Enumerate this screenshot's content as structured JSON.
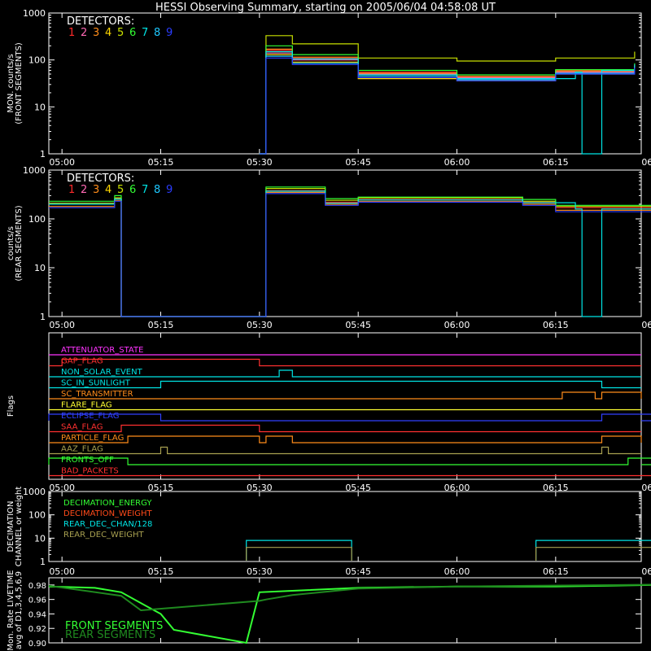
{
  "title": "HESSI Observing Summary, starting on 2005/06/04 04:58:08 UT",
  "x_tick_labels": [
    "05:00",
    "05:15",
    "05:30",
    "05:45",
    "06:00",
    "06:15",
    "06:30"
  ],
  "detector_colors": [
    "#ff2a2a",
    "#ff69b4",
    "#ff8c1a",
    "#ffd700",
    "#c8e000",
    "#33ff33",
    "#00e5e5",
    "#1ec8ff",
    "#2b3dff"
  ],
  "chart_data": [
    {
      "type": "line",
      "title": "HESSI Observing Summary, starting on 2005/06/04 04:58:08 UT",
      "ylabel": "MON. counts/s (FRONT SEGMENTS)",
      "yscale": "log",
      "ylim": [
        1,
        1000
      ],
      "y_tick_labels": [
        "1",
        "10",
        "100",
        "1000"
      ],
      "x_tick_labels": [
        "05:00",
        "05:15",
        "05:30",
        "05:45",
        "06:00",
        "06:15",
        "06:30"
      ],
      "xlim_minutes": [
        298,
        388
      ],
      "legend_title": "DETECTORS:",
      "legend_entries": [
        "1",
        "2",
        "3",
        "4",
        "5",
        "6",
        "7",
        "8",
        "9"
      ],
      "series": [
        {
          "detector": "1",
          "x": [
            "05:30",
            "05:31",
            "05:35",
            "05:45",
            "06:00",
            "06:15",
            "06:27"
          ],
          "y": [
            1,
            160,
            110,
            55,
            45,
            60,
            80
          ]
        },
        {
          "detector": "2",
          "x": [
            "05:30",
            "05:31",
            "05:35",
            "05:45",
            "06:00",
            "06:15",
            "06:27"
          ],
          "y": [
            1,
            140,
            100,
            50,
            42,
            55,
            75
          ]
        },
        {
          "detector": "3",
          "x": [
            "05:30",
            "05:31",
            "05:35",
            "05:45",
            "06:00",
            "06:15",
            "06:27"
          ],
          "y": [
            1,
            170,
            115,
            52,
            44,
            58,
            78
          ]
        },
        {
          "detector": "4",
          "x": [
            "05:30",
            "05:31",
            "05:35",
            "05:45",
            "06:00",
            "06:15",
            "06:27"
          ],
          "y": [
            1,
            130,
            90,
            40,
            36,
            50,
            70
          ]
        },
        {
          "detector": "5",
          "x": [
            "05:30",
            "05:31",
            "05:35",
            "05:45",
            "06:00",
            "06:15",
            "06:27"
          ],
          "y": [
            1,
            330,
            220,
            110,
            95,
            110,
            150
          ]
        },
        {
          "detector": "6",
          "x": [
            "05:30",
            "05:31",
            "05:35",
            "05:45",
            "06:00",
            "06:15",
            "06:27"
          ],
          "y": [
            1,
            200,
            130,
            60,
            48,
            62,
            85
          ]
        },
        {
          "detector": "7",
          "x": [
            "05:30",
            "05:31",
            "05:35",
            "05:45",
            "06:00",
            "06:18",
            "06:19",
            "06:22",
            "06:27"
          ],
          "y": [
            1,
            150,
            105,
            48,
            40,
            55,
            1,
            60,
            80
          ]
        },
        {
          "detector": "8",
          "x": [
            "05:30",
            "05:31",
            "05:35",
            "05:45",
            "06:00",
            "06:15",
            "06:27"
          ],
          "y": [
            1,
            120,
            85,
            45,
            38,
            52,
            72
          ]
        },
        {
          "detector": "9",
          "x": [
            "05:30",
            "05:31",
            "05:35",
            "05:45",
            "06:00",
            "06:15",
            "06:27"
          ],
          "y": [
            1,
            110,
            80,
            42,
            36,
            50,
            68
          ]
        }
      ]
    },
    {
      "type": "line",
      "ylabel": "counts/s (REAR SEGMENTS)",
      "yscale": "log",
      "ylim": [
        1,
        1000
      ],
      "y_tick_labels": [
        "1",
        "10",
        "100",
        "1000"
      ],
      "x_tick_labels": [
        "05:00",
        "05:15",
        "05:30",
        "05:45",
        "06:00",
        "06:15",
        "06:30"
      ],
      "xlim_minutes": [
        298,
        388
      ],
      "legend_title": "DETECTORS:",
      "legend_entries": [
        "1",
        "2",
        "3",
        "4",
        "5",
        "6",
        "7",
        "8",
        "9"
      ],
      "series": [
        {
          "detector": "1",
          "x": [
            "04:58",
            "05:08",
            "05:09",
            "05:30",
            "05:31",
            "05:40",
            "05:45",
            "06:10",
            "06:15",
            "06:30",
            "06:37"
          ],
          "y": [
            200,
            260,
            1,
            1,
            380,
            220,
            250,
            220,
            170,
            160,
            250
          ]
        },
        {
          "detector": "3",
          "x": [
            "04:58",
            "05:08",
            "05:09",
            "05:30",
            "05:31",
            "05:40",
            "05:45",
            "06:10",
            "06:15",
            "06:30",
            "06:37"
          ],
          "y": [
            180,
            240,
            1,
            1,
            350,
            200,
            230,
            200,
            150,
            145,
            230
          ]
        },
        {
          "detector": "5",
          "x": [
            "04:58",
            "05:08",
            "05:09",
            "05:30",
            "05:31",
            "05:40",
            "05:45",
            "06:10",
            "06:15",
            "06:30",
            "06:37"
          ],
          "y": [
            210,
            270,
            1,
            1,
            420,
            240,
            270,
            230,
            180,
            170,
            260
          ]
        },
        {
          "detector": "6",
          "x": [
            "04:58",
            "05:08",
            "05:09",
            "05:30",
            "05:31",
            "05:40",
            "05:45",
            "06:10",
            "06:15",
            "06:30",
            "06:37"
          ],
          "y": [
            230,
            300,
            1,
            1,
            450,
            260,
            280,
            250,
            190,
            180,
            280
          ]
        },
        {
          "detector": "7",
          "x": [
            "04:58",
            "05:08",
            "05:09",
            "05:30",
            "05:31",
            "05:40",
            "05:45",
            "06:10",
            "06:18",
            "06:19",
            "06:22",
            "06:30",
            "06:37"
          ],
          "y": [
            200,
            255,
            1,
            1,
            370,
            210,
            245,
            215,
            160,
            1,
            160,
            155,
            240
          ]
        },
        {
          "detector": "9",
          "x": [
            "04:58",
            "05:08",
            "05:09",
            "05:30",
            "05:31",
            "05:40",
            "05:45",
            "06:10",
            "06:15",
            "06:30",
            "06:37"
          ],
          "y": [
            170,
            230,
            1,
            1,
            330,
            190,
            220,
            190,
            140,
            135,
            220
          ]
        }
      ]
    },
    {
      "type": "line",
      "ylabel": "Flags",
      "x_tick_labels": [
        "05:00",
        "05:15",
        "05:30",
        "05:45",
        "06:00",
        "06:15",
        "06:30"
      ],
      "flags": [
        {
          "name": "ATTENUATOR_STATE",
          "color": "#ff33ff",
          "on": []
        },
        {
          "name": "GAP_FLAG",
          "color": "#ff3030",
          "on": [
            [
              "05:00",
              "05:30"
            ]
          ]
        },
        {
          "name": "NON_SOLAR_EVENT",
          "color": "#00e5e5",
          "on": [
            [
              "05:33",
              "05:35"
            ]
          ]
        },
        {
          "name": "SC_IN_SUNLIGHT",
          "color": "#00e5e5",
          "on": [
            [
              "05:15",
              "06:22"
            ]
          ]
        },
        {
          "name": "SC_TRANSMITTER",
          "color": "#ff8c1a",
          "on": [
            [
              "06:16",
              "06:21"
            ],
            [
              "06:22",
              "06:28"
            ]
          ]
        },
        {
          "name": "FLARE_FLAG",
          "color": "#ffff33",
          "on": []
        },
        {
          "name": "ECLIPSE_FLAG",
          "color": "#3040ff",
          "on": [
            [
              "04:58",
              "05:15"
            ],
            [
              "06:22",
              "06:37"
            ]
          ]
        },
        {
          "name": "SAA_FLAG",
          "color": "#ff3030",
          "on": [
            [
              "05:09",
              "05:30"
            ]
          ]
        },
        {
          "name": "PARTICLE_FLAG",
          "color": "#ff8c1a",
          "on": [
            [
              "05:10",
              "05:30"
            ],
            [
              "05:31",
              "05:35"
            ],
            [
              "06:22",
              "06:28"
            ]
          ]
        },
        {
          "name": "AAZ_FLAG",
          "color": "#a8a050",
          "on": [
            [
              "05:15",
              "05:16"
            ],
            [
              "06:22",
              "06:23"
            ]
          ]
        },
        {
          "name": "FRONTS_OFF",
          "color": "#33ff33",
          "on": [
            [
              "04:58",
              "05:10"
            ],
            [
              "06:26",
              "06:37"
            ]
          ]
        },
        {
          "name": "BAD_PACKETS",
          "color": "#ff3030",
          "on": [
            [
              "06:37",
              "06:37"
            ]
          ]
        }
      ]
    },
    {
      "type": "line",
      "ylabel": "DECIMATION CHANNEL or weight",
      "yscale": "log",
      "ylim": [
        1,
        1000
      ],
      "y_tick_labels": [
        "1",
        "10",
        "100",
        "1000"
      ],
      "x_tick_labels": [
        "05:00",
        "05:15",
        "05:30",
        "05:45",
        "06:00",
        "06:15",
        "06:30"
      ],
      "legend_entries": [
        "DECIMATION_ENERGY",
        "DECIMATION_WEIGHT",
        "REAR_DEC_CHAN/128",
        "REAR_DEC_WEIGHT"
      ],
      "series": [
        {
          "name": "REAR_DEC_CHAN/128",
          "color": "#00e5e5",
          "x": [
            "05:28",
            "05:44",
            "06:12",
            "06:36"
          ],
          "y": [
            8,
            8,
            8,
            8
          ]
        },
        {
          "name": "REAR_DEC_WEIGHT",
          "color": "#a8a050",
          "x": [
            "05:28",
            "05:44",
            "06:12",
            "06:36"
          ],
          "y": [
            4,
            4,
            4,
            4
          ]
        }
      ]
    },
    {
      "type": "line",
      "ylabel": "Mon. Rate LIVETIME avg of D1,3,4,5,6,9",
      "ylim": [
        0.9,
        0.99
      ],
      "y_tick_labels": [
        "0.90",
        "0.92",
        "0.94",
        "0.96",
        "0.98"
      ],
      "legend_entries": [
        "FRONT SEGMENTS",
        "REAR SEGMENTS"
      ],
      "series": [
        {
          "name": "FRONT SEGMENTS",
          "color": "#33ff33",
          "x": [
            "04:58",
            "05:05",
            "05:09",
            "05:13",
            "05:15",
            "05:17",
            "05:28",
            "05:30",
            "05:35",
            "05:45",
            "06:00",
            "06:15",
            "06:37"
          ],
          "y": [
            0.978,
            0.976,
            0.97,
            0.95,
            0.94,
            0.918,
            0.9,
            0.97,
            0.972,
            0.976,
            0.978,
            0.978,
            0.981
          ]
        },
        {
          "name": "REAR SEGMENTS",
          "color": "#1f8a1f",
          "x": [
            "04:58",
            "05:09",
            "05:12",
            "05:30",
            "05:31",
            "05:35",
            "05:45",
            "06:00",
            "06:37"
          ],
          "y": [
            0.979,
            0.965,
            0.945,
            0.958,
            0.96,
            0.966,
            0.975,
            0.978,
            0.981
          ]
        }
      ]
    }
  ]
}
